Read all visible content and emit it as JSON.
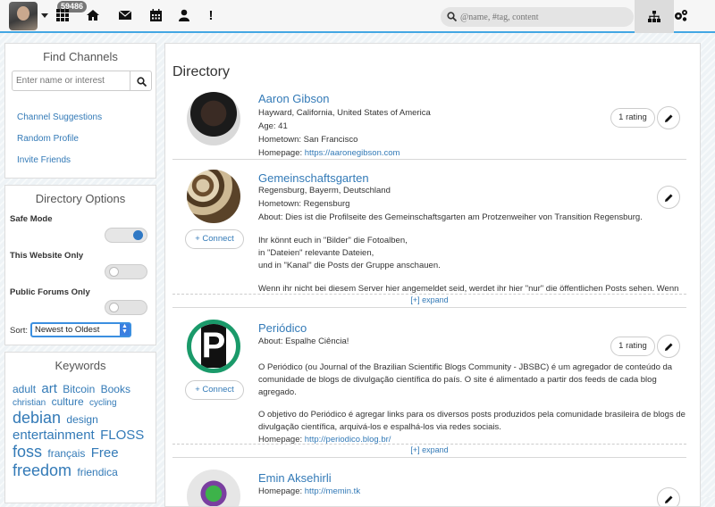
{
  "navbar": {
    "badge": "59486",
    "search_placeholder": "@name, #tag, content"
  },
  "find_channels": {
    "title": "Find Channels",
    "input_placeholder": "Enter name or interest",
    "links": [
      "Channel Suggestions",
      "Random Profile",
      "Invite Friends"
    ]
  },
  "directory_options": {
    "title": "Directory Options",
    "safe_mode": "Safe Mode",
    "safe_mode_on": true,
    "this_website_only": "This Website Only",
    "public_forums_only": "Public Forums Only",
    "sort_label": "Sort:",
    "sort_value": "Newest to Oldest"
  },
  "keywords": {
    "title": "Keywords",
    "items": [
      {
        "text": "adult",
        "size": "s"
      },
      {
        "text": "art",
        "size": "l"
      },
      {
        "text": "Bitcoin",
        "size": "s"
      },
      {
        "text": "Books",
        "size": "s"
      },
      {
        "text": "christian",
        "size": "xs"
      },
      {
        "text": "culture",
        "size": "s"
      },
      {
        "text": "cycling",
        "size": "xs"
      },
      {
        "text": "debian",
        "size": "xl"
      },
      {
        "text": "design",
        "size": "s"
      },
      {
        "text": "entertainment",
        "size": "l"
      },
      {
        "text": "FLOSS",
        "size": "l"
      },
      {
        "text": "foss",
        "size": "xl"
      },
      {
        "text": "français",
        "size": "s"
      },
      {
        "text": "Free",
        "size": "l"
      },
      {
        "text": "freedom",
        "size": "xl"
      },
      {
        "text": "friendica",
        "size": "s"
      }
    ]
  },
  "directory": {
    "title": "Directory",
    "expand_label": "[+] expand",
    "connect_label": "Connect",
    "entries": [
      {
        "name": "Aaron Gibson",
        "location": "Hayward, California, United States of America",
        "age": "Age: 41",
        "hometown": "Hometown: San Francisco",
        "homepage_label": "Homepage:",
        "homepage": "https://aaronegibson.com",
        "rating": "1 rating"
      },
      {
        "name": "Gemeinschaftsgarten",
        "location": "Regensburg, Bayerm, Deutschland",
        "hometown": "Hometown: Regensburg",
        "about": "About: Dies ist die Profilseite des Gemeinschaftsgarten am Protzenweiher von Transition Regensburg.",
        "text1": "Ihr könnt euch in \"Bilder\" die Fotoalben,",
        "text2": "in \"Dateien\" relevante Dateien,",
        "text3": "und in \"Kanal\" die Posts der Gruppe anschauen.",
        "text4": "Wenn ihr nicht bei diesem Server hier angemeldet seid, werdet ihr hier \"nur\" die öffentlichen Posts sehen. Wenn"
      },
      {
        "name": "Periódico",
        "about": "About: Espalhe Ciência!",
        "rating": "1 rating",
        "text1": "O Periódico (ou Journal of the Brazilian Scientific Blogs Community - JBSBC) é um agregador de conteúdo da",
        "text2": "comunidade de blogs de divulgação científica do país. O site é alimentado a partir dos feeds de cada blog",
        "text3": "agregado.",
        "text4": "O objetivo do Periódico é agregar links para os diversos posts produzidos pela comunidade brasileira de blogs de",
        "text5": "divulgação científica, arquivá-los e espalhá-los via redes sociais.",
        "homepage_label": "Homepage:",
        "homepage": "http://periodico.blog.br/",
        "logo_letter": "P"
      },
      {
        "name": "Emin Aksehirli",
        "homepage_label": "Homepage:",
        "homepage": "http://memin.tk"
      }
    ]
  }
}
